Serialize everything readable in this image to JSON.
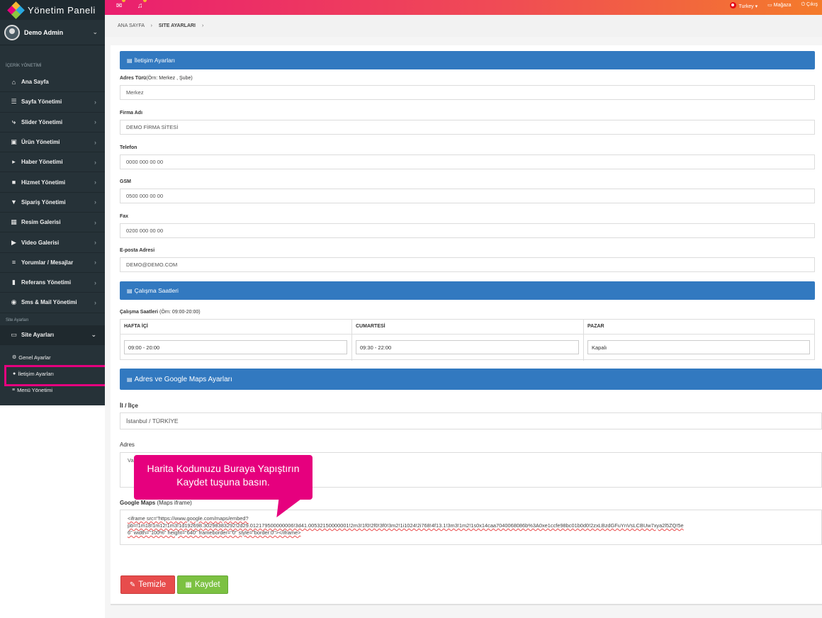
{
  "brand": {
    "title": "Yönetim Paneli"
  },
  "user": {
    "name": "Demo Admin"
  },
  "sidebar": {
    "section_content": "İÇERİK YÖNETİMİ",
    "items": [
      {
        "label": "Ana Sayfa",
        "icon": "home-icon"
      },
      {
        "label": "Sayfa Yönetimi",
        "icon": "sitemap-icon"
      },
      {
        "label": "Slider Yönetimi",
        "icon": "bolt-icon"
      },
      {
        "label": "Ürün Yönetimi",
        "icon": "cubes-icon"
      },
      {
        "label": "Haber Yönetimi",
        "icon": "bullhorn-icon"
      },
      {
        "label": "Hizmet Yönetimi",
        "icon": "briefcase-icon"
      },
      {
        "label": "Sipariş Yönetimi",
        "icon": "cart-icon"
      },
      {
        "label": "Resim Galerisi",
        "icon": "image-icon"
      },
      {
        "label": "Video Galerisi",
        "icon": "video-icon"
      },
      {
        "label": "Yorumlar / Mesajlar",
        "icon": "list-icon"
      },
      {
        "label": "Referans Yönetimi",
        "icon": "bookmark-icon"
      },
      {
        "label": "Sms & Mail Yönetimi",
        "icon": "globe-icon"
      }
    ],
    "section_site": "Site Ayarları",
    "site_item": "Site Ayarları",
    "sub_items": [
      "Genel Ayarlar",
      "İletişim Ayarları",
      "Menü  Yönetimi"
    ]
  },
  "topbar": {
    "language": "Turkey",
    "store": "Mağaza",
    "logout": "Çıkış"
  },
  "breadcrumb": {
    "home": "ANA SAYFA",
    "current": "SITE AYARLARI"
  },
  "contact": {
    "title": "İletişim Ayarları",
    "address_type_label": "Adres Türü",
    "address_type_hint": "(Örn: Merkez , Şube)",
    "address_type_value": "Merkez",
    "company_label": "Firma Adı",
    "company_value": "DEMO FİRMA SİTESİ",
    "phone_label": "Telefon",
    "phone_value": "0000 000 00 00",
    "gsm_label": "GSM",
    "gsm_value": "0500 000 00 00",
    "fax_label": "Fax",
    "fax_value": "0200 000 00 00",
    "email_label": "E-posta Adresi",
    "email_value": "DEMO@DEMO.COM"
  },
  "hours": {
    "title": "Çalışma Saatleri",
    "label": "Çalışma Saatleri",
    "hint": "(Örn: 09:00-20:00)",
    "columns": [
      {
        "header": "HAFTA İÇİ",
        "value": "09:00 - 20:00"
      },
      {
        "header": "CUMARTESİ",
        "value": "09:30 - 22:00"
      },
      {
        "header": "PAZAR",
        "value": "Kapalı"
      }
    ]
  },
  "maps": {
    "title": "Adres ve Google Maps Ayarları",
    "city_label": "İl / İlçe",
    "city_value": "İstanbul / TÜRKİYE",
    "address_label": "Adres",
    "address_value": "Va",
    "gmaps_label": "Google Maps",
    "gmaps_hint": "(Maps iframe)",
    "iframe_line1": "<iframe src=\"https://www.google.com/maps/embed?",
    "iframe_line2": "pb=!1m18!1m12!1m3!1d192698.30298383292!2d29.012179500000006!3d41.00532150000001!2m3!1f0!2f0!3f0!3m2!1i1024!2i768!4f13.1!3m3!1m2!1s0x14caa7040068086b%3A0xe1ccfe98bc01b0d0!2zxLBzdGFuYnVsLCBUw7xya2l5ZQ!5e",
    "iframe_line3": "6\" width=\"100%\" height=\"640\" frameborder=\"0\" style=\"border:0\"></iframe>"
  },
  "buttons": {
    "clear": "Temizle",
    "save": "Kaydet"
  },
  "callout": {
    "line1": "Harita Kodunuzu Buraya Yapıştırın",
    "line2": "Kaydet tuşuna basın."
  },
  "colors": {
    "sidebar": "#263238",
    "accent_pink": "#e6007e",
    "panel_blue": "#3279c0",
    "btn_red": "#e74c4c",
    "btn_green": "#7cc142"
  }
}
